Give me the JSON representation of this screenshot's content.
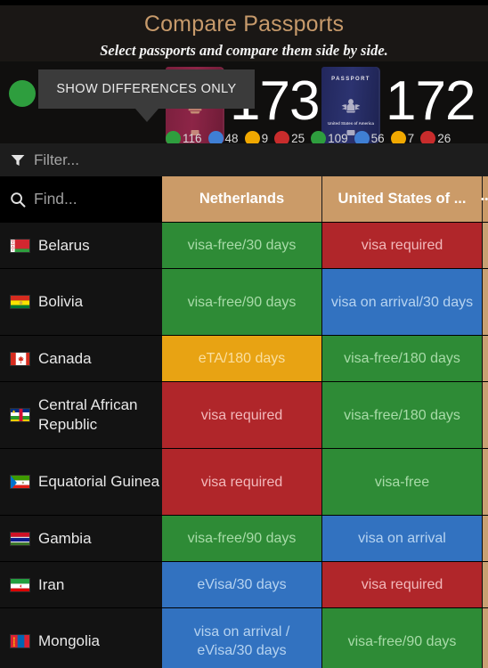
{
  "header": {
    "title": "Compare Passports",
    "subtitle": "Select passports and compare them side by side."
  },
  "tooltip": {
    "text": "SHOW DIFFERENCES ONLY"
  },
  "selector": {
    "swatches": [
      {
        "name": "green-filter-dot",
        "color": "#2e9e3e"
      },
      {
        "name": "blue-filter-dot",
        "color": "#3f7fd4"
      },
      {
        "name": "orange-filter-dot",
        "color": "#f0a800"
      },
      {
        "name": "red-filter-dot",
        "color": "#c82c2c"
      }
    ],
    "contrast_toggle_icon": "contrast-half-circle-icon"
  },
  "passports": [
    {
      "country": "Netherlands",
      "score": "173",
      "cover_title": "PASSPORT",
      "cover_subtitle": "",
      "legend": [
        {
          "color": "#2e9e3e",
          "count": "116"
        },
        {
          "color": "#3f7fd4",
          "count": "48"
        },
        {
          "color": "#f0a800",
          "count": "9"
        },
        {
          "color": "#c82c2c",
          "count": "25"
        }
      ]
    },
    {
      "country": "United States of ...",
      "score": "172",
      "cover_title": "PASSPORT",
      "cover_subtitle": "United States of America",
      "legend": [
        {
          "color": "#2e9e3e",
          "count": "109"
        },
        {
          "color": "#3f7fd4",
          "count": "56"
        },
        {
          "color": "#f0a800",
          "count": "7"
        },
        {
          "color": "#c82c2c",
          "count": "26"
        }
      ]
    }
  ],
  "filter": {
    "placeholder": "Filter...",
    "icon": "funnel-icon"
  },
  "search": {
    "placeholder": "Find...",
    "icon": "search-icon"
  },
  "table": {
    "columns": [
      "",
      "Netherlands",
      "United States of ..."
    ],
    "rows": [
      {
        "country": "Belarus",
        "flag": "belarus",
        "cells": [
          {
            "text": "visa-free/30 days",
            "status": "green"
          },
          {
            "text": "visa required",
            "status": "red"
          }
        ]
      },
      {
        "country": "Bolivia",
        "flag": "bolivia",
        "cells": [
          {
            "text": "visa-free/90 days",
            "status": "green"
          },
          {
            "text": "visa on arrival/30 days",
            "status": "blue"
          }
        ]
      },
      {
        "country": "Canada",
        "flag": "canada",
        "cells": [
          {
            "text": "eTA/180 days",
            "status": "orange"
          },
          {
            "text": "visa-free/180 days",
            "status": "green"
          }
        ]
      },
      {
        "country": "Central African Republic",
        "flag": "car",
        "cells": [
          {
            "text": "visa required",
            "status": "red"
          },
          {
            "text": "visa-free/180 days",
            "status": "green"
          }
        ]
      },
      {
        "country": "Equatorial Guinea",
        "flag": "eqguinea",
        "cells": [
          {
            "text": "visa required",
            "status": "red"
          },
          {
            "text": "visa-free",
            "status": "green"
          }
        ]
      },
      {
        "country": "Gambia",
        "flag": "gambia",
        "cells": [
          {
            "text": "visa-free/90 days",
            "status": "green"
          },
          {
            "text": "visa on arrival",
            "status": "blue"
          }
        ]
      },
      {
        "country": "Iran",
        "flag": "iran",
        "cells": [
          {
            "text": "eVisa/30 days",
            "status": "blue"
          },
          {
            "text": "visa required",
            "status": "red"
          }
        ]
      },
      {
        "country": "Mongolia",
        "flag": "mongolia",
        "cells": [
          {
            "text": "visa on arrival / eVisa/30 days",
            "status": "blue"
          },
          {
            "text": "visa-free/90 days",
            "status": "green"
          }
        ]
      }
    ]
  },
  "colors": {
    "accent": "#c79a6b",
    "header_bg": "#cb9b68",
    "green": "#2e8b36",
    "blue": "#3272c0",
    "orange": "#e8a313",
    "red": "#b0262a"
  }
}
